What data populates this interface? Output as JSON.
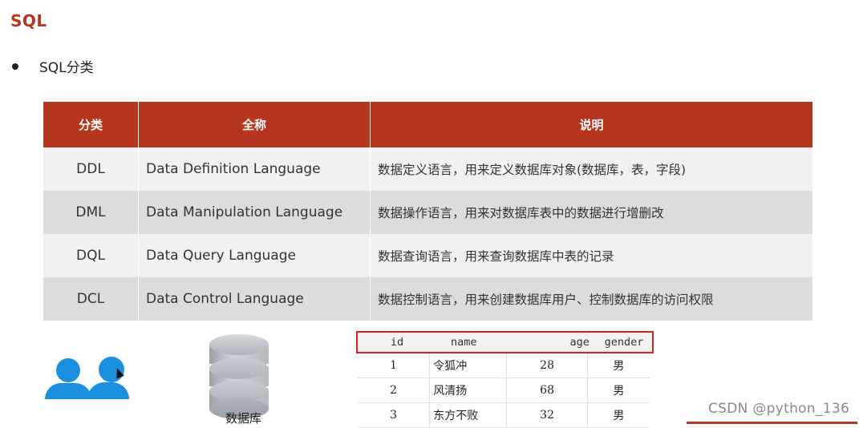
{
  "slide": {
    "title": "SQL",
    "bullet": "SQL分类"
  },
  "table": {
    "headers": [
      "分类",
      "全称",
      "说明"
    ],
    "rows": [
      {
        "abbr": "DDL",
        "full": "Data Definition Language",
        "desc": "数据定义语言，用来定义数据库对象(数据库，表，字段)"
      },
      {
        "abbr": "DML",
        "full": "Data Manipulation Language",
        "desc": "数据操作语言，用来对数据库表中的数据进行增删改"
      },
      {
        "abbr": "DQL",
        "full": "Data Query Language",
        "desc": "数据查询语言，用来查询数据库中表的记录"
      },
      {
        "abbr": "DCL",
        "full": "Data Control Language",
        "desc": "数据控制语言，用来创建数据库用户、控制数据库的访问权限"
      }
    ]
  },
  "diagram": {
    "db_label": "数据库",
    "demo_headers": [
      "id",
      "name",
      "age",
      "gender"
    ],
    "demo_rows": [
      {
        "id": "1",
        "name": "令狐冲",
        "age": "28",
        "gender": "男"
      },
      {
        "id": "2",
        "name": "风清扬",
        "age": "68",
        "gender": "男"
      },
      {
        "id": "3",
        "name": "东方不败",
        "age": "32",
        "gender": "男"
      }
    ]
  },
  "watermark": "CSDN @python_136",
  "colors": {
    "accent": "#b5361f",
    "user_icon": "#1a8fdf",
    "highlight_border": "#e02020"
  }
}
